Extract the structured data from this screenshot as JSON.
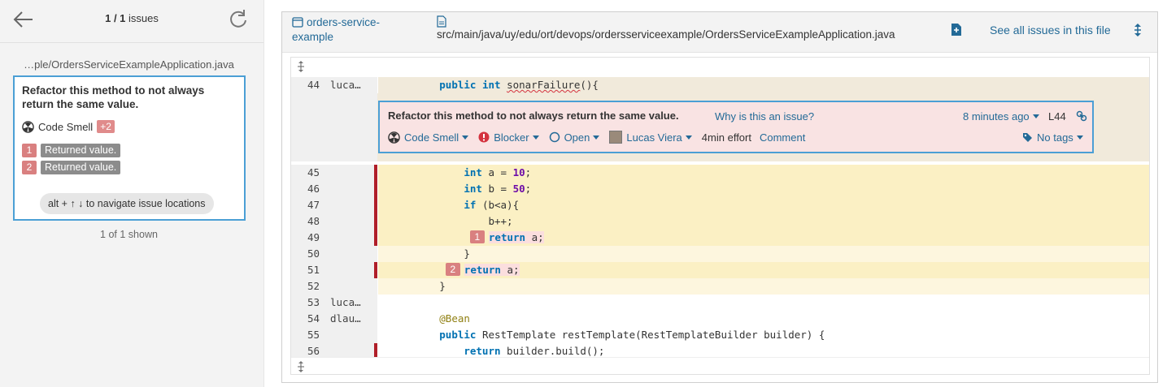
{
  "left": {
    "pager_current": "1 / 1",
    "pager_suffix": " issues",
    "file_label": "…ple/OrdersServiceExampleApplication.java",
    "issue": {
      "title": "Refactor this method to not always return the same value.",
      "type": "Code Smell",
      "extra_count": "+2",
      "locations": [
        {
          "num": "1",
          "text": "Returned value."
        },
        {
          "num": "2",
          "text": "Returned value."
        }
      ],
      "nav_hint": "alt + ↑ ↓ to navigate issue locations"
    },
    "shown": "1 of 1 shown"
  },
  "viewer": {
    "project": "orders-service-example",
    "path": "src/main/java/uy/edu/ort/devops/ordersserviceexample/OrdersServiceExampleApplication.java",
    "see_all": "See all issues in this file"
  },
  "code": {
    "line44": {
      "num": "44",
      "blame": "luca…"
    },
    "issue_box": {
      "title": "Refactor this method to not always return the same value.",
      "why": "Why is this an issue?",
      "time": "8 minutes ago",
      "line": "L44",
      "type": "Code Smell",
      "severity": "Blocker",
      "status": "Open",
      "assignee": "Lucas Viera",
      "effort": "4min effort",
      "comment": "Comment",
      "tags": "No tags"
    },
    "lines": [
      {
        "num": "45",
        "blame": ""
      },
      {
        "num": "46",
        "blame": ""
      },
      {
        "num": "47",
        "blame": ""
      },
      {
        "num": "48",
        "blame": ""
      },
      {
        "num": "49",
        "blame": ""
      },
      {
        "num": "50",
        "blame": ""
      },
      {
        "num": "51",
        "blame": ""
      },
      {
        "num": "52",
        "blame": ""
      },
      {
        "num": "53",
        "blame": "luca…"
      },
      {
        "num": "54",
        "blame": "dlau…"
      },
      {
        "num": "55",
        "blame": ""
      },
      {
        "num": "56",
        "blame": ""
      }
    ],
    "loc1": "1",
    "loc2": "2"
  },
  "colors": {
    "accent": "#236a97",
    "focus_border": "#4b9fd5",
    "scm_red": "#b01e28",
    "issue_bg": "#f9e3e3"
  }
}
